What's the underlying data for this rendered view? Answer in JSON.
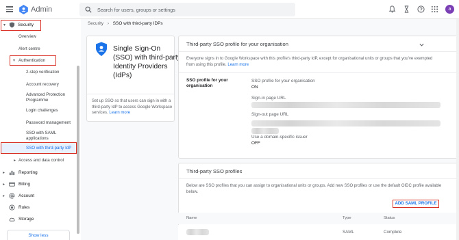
{
  "topbar": {
    "app_title": "Admin",
    "search_placeholder": "Search for users, groups or settings",
    "avatar_letter": "a",
    "icons": [
      "bell-icon",
      "hourglass-icon",
      "help-icon",
      "apps-grid-icon"
    ]
  },
  "sidebar": {
    "security": "Security",
    "overview": "Overview",
    "alert_centre": "Alert centre",
    "authentication": "Authentication",
    "two_step": "2-step verification",
    "account_recovery": "Account recovery",
    "advanced_protection": "Advanced Protection Programme",
    "login_challenges": "Login challenges",
    "password_management": "Password management",
    "sso_saml": "SSO with SAML applications",
    "sso_third_party": "SSO with third-party IdP",
    "access_data_control": "Access and data control",
    "reporting": "Reporting",
    "billing": "Billing",
    "account": "Account",
    "rules": "Rules",
    "storage": "Storage",
    "show_less": "Show less"
  },
  "breadcrumb": {
    "root": "Security",
    "separator": "›",
    "current": "SSO with third-party IDPs"
  },
  "intro_card": {
    "title": "Single Sign-On (SSO) with third-party Identity Providers (IdPs)",
    "description": "Set up SSO so that users can sign in with a third-party IdP to access Google Workspace services.",
    "learn_more": "Learn more"
  },
  "profile_panel": {
    "title": "Third-party SSO profile for your organisation",
    "description": "Everyone signs in to Google Workspace with this profile's third-party IdP, except for organisational units or groups that you've exempted from using this profile.",
    "learn_more": "Learn more",
    "section_label": "SSO profile for your organisation",
    "fields": {
      "sso_profile_label": "SSO profile for your organisation",
      "sso_profile_value": "ON",
      "sign_in_label": "Sign-in page URL",
      "sign_out_label": "Sign-out page URL",
      "issuer_label": "Use a domain-specific issuer",
      "issuer_value": "OFF"
    }
  },
  "profiles_panel": {
    "title": "Third-party SSO profiles",
    "description": "Below are SSO profiles that you can assign to organisational units or groups. Add new SSO profiles or use the default OIDC profile available below.",
    "add_button": "ADD SAML PROFILE",
    "columns": [
      "Name",
      "Type",
      "Status"
    ],
    "rows": [
      {
        "type": "SAML",
        "status": "Complete"
      }
    ]
  },
  "colors": {
    "accent": "#1a73e8",
    "highlight": "#d93025",
    "avatar": "#7b3fb5"
  }
}
